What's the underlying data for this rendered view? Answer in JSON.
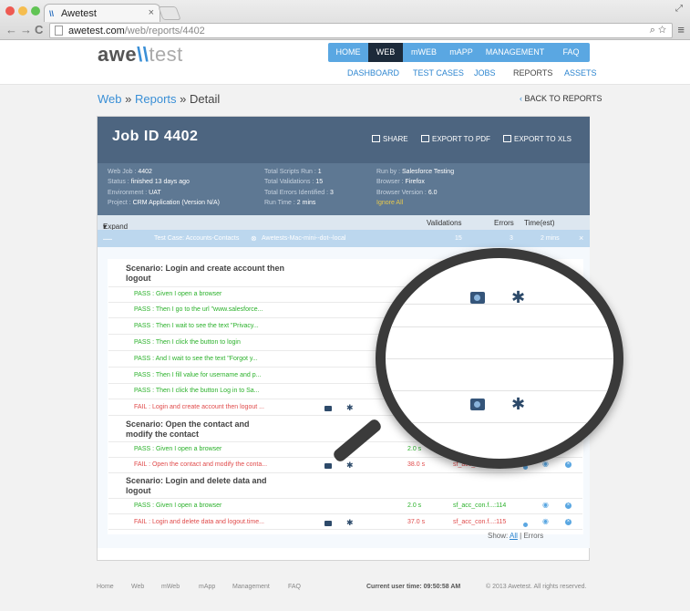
{
  "browser": {
    "tab_title": "Awetest",
    "tab_favicon": "\\\\",
    "tab_close": "×",
    "url_host": "awetest.com",
    "url_path": "/web/reports/4402",
    "back": "←",
    "forward": "→",
    "reload": "C",
    "zoom_icon": "⌕",
    "star_icon": "☆",
    "menu_icon": "≡",
    "expand_icon": "⤢",
    "traffic_colors": [
      "#ee5a52",
      "#f5bd4f",
      "#61c454"
    ]
  },
  "header": {
    "logo": {
      "a": "awe",
      "b": "\\\\",
      "c": "test"
    },
    "main_nav": [
      "HOME",
      "WEB",
      "mWEB",
      "mAPP",
      "MANAGEMENT",
      "FAQ"
    ],
    "main_nav_active": "WEB",
    "sub_nav": [
      "DASHBOARD",
      "TEST CASES",
      "JOBS",
      "REPORTS",
      "ASSETS"
    ],
    "sub_nav_active": "REPORTS"
  },
  "breadcrumb": {
    "web": "Web",
    "sep1": "»",
    "reports": "Reports",
    "sep2": "»",
    "detail": "Detail"
  },
  "back_link": {
    "chevron": "‹",
    "label": "BACK TO REPORTS"
  },
  "job": {
    "title": "Job ID 4402",
    "actions": {
      "share": "SHARE",
      "pdf": "EXPORT TO PDF",
      "xls": "EXPORT TO XLS"
    },
    "info": {
      "web_job_label": "Web Job : ",
      "web_job": "4402",
      "status_label": "Status : ",
      "status": "finished 13 days ago",
      "environment_label": "Environment : ",
      "environment": "UAT",
      "project_label": "Project : ",
      "project": "CRM Application (Version N/A)",
      "scripts_label": "Total Scripts Run : ",
      "scripts": "1",
      "validations_label": "Total Validations : ",
      "validations": "15",
      "errors_label": "Total Errors Identified : ",
      "errors": "3",
      "runtime_label": "Run Time : ",
      "runtime": "2 mins",
      "runby_label": "Run by : ",
      "runby": "Salesforce Testing",
      "browser_label": "Browser : ",
      "browser": "Firefox",
      "browser_version_label": "Browser Version : ",
      "browser_version": "6.0",
      "ignore_all": "Ignore All"
    }
  },
  "table": {
    "expand": "Expand",
    "expand_caret": "▾",
    "col_validations": "Validations",
    "col_errors": "Errors",
    "col_time": "Time(est)",
    "test_case": {
      "minus": "—",
      "label": "Test Case: Accounts-Contacts",
      "machine_icon": "⊗",
      "machine": "Awetests-Mac-mini--dot--local",
      "validations": "15",
      "errors": "3",
      "time": "2 mins",
      "close": "×"
    }
  },
  "scenarios": [
    {
      "title": "Scenario: Login and create account then logout"
    },
    {
      "title": "Scenario: Open the contact and modify the contact"
    },
    {
      "title": "Scenario: Login and delete data and logout"
    }
  ],
  "steps": [
    {
      "text": "PASS : Given I open a browser"
    },
    {
      "text": "PASS : Then I go to the url \"www.salesforce..."
    },
    {
      "text": "PASS : Then I wait to see the text \"Privacy..."
    },
    {
      "text": "PASS : Then I click the button to login"
    },
    {
      "text": "PASS : And I wait to see the text \"Forgot y..."
    },
    {
      "text": "PASS : Then I fill value for username and p..."
    },
    {
      "text": "PASS : Then I click the button Log in to Sa..."
    },
    {
      "text": "FAIL : Login and create account then logout ..."
    },
    {
      "text": "PASS : Given I open a browser",
      "dur": "2.0 s"
    },
    {
      "text": "FAIL : Open the contact and modify the conta...",
      "dur": "38.0 s",
      "ref": "sf_acc_c"
    },
    {
      "text": "PASS : Given I open a browser",
      "dur": "2.0 s",
      "ref": "sf_acc_con.f...:114"
    },
    {
      "text": "FAIL : Login and delete data and logout.time...",
      "dur": "37.0 s",
      "ref": "sf_acc_con.f...:115"
    }
  ],
  "icons": {
    "bug": "✱",
    "eye": "◉",
    "close": "×"
  },
  "show": {
    "label": "Show:",
    "all": "All",
    "sep": "|",
    "errors": "Errors"
  },
  "footer": {
    "links": [
      "Home",
      "Web",
      "mWeb",
      "mApp",
      "Management",
      "FAQ"
    ],
    "time_label": "Current user time:",
    "time": "09:50:58 AM",
    "copyright": "© 2013 Awetest. All rights reserved."
  }
}
